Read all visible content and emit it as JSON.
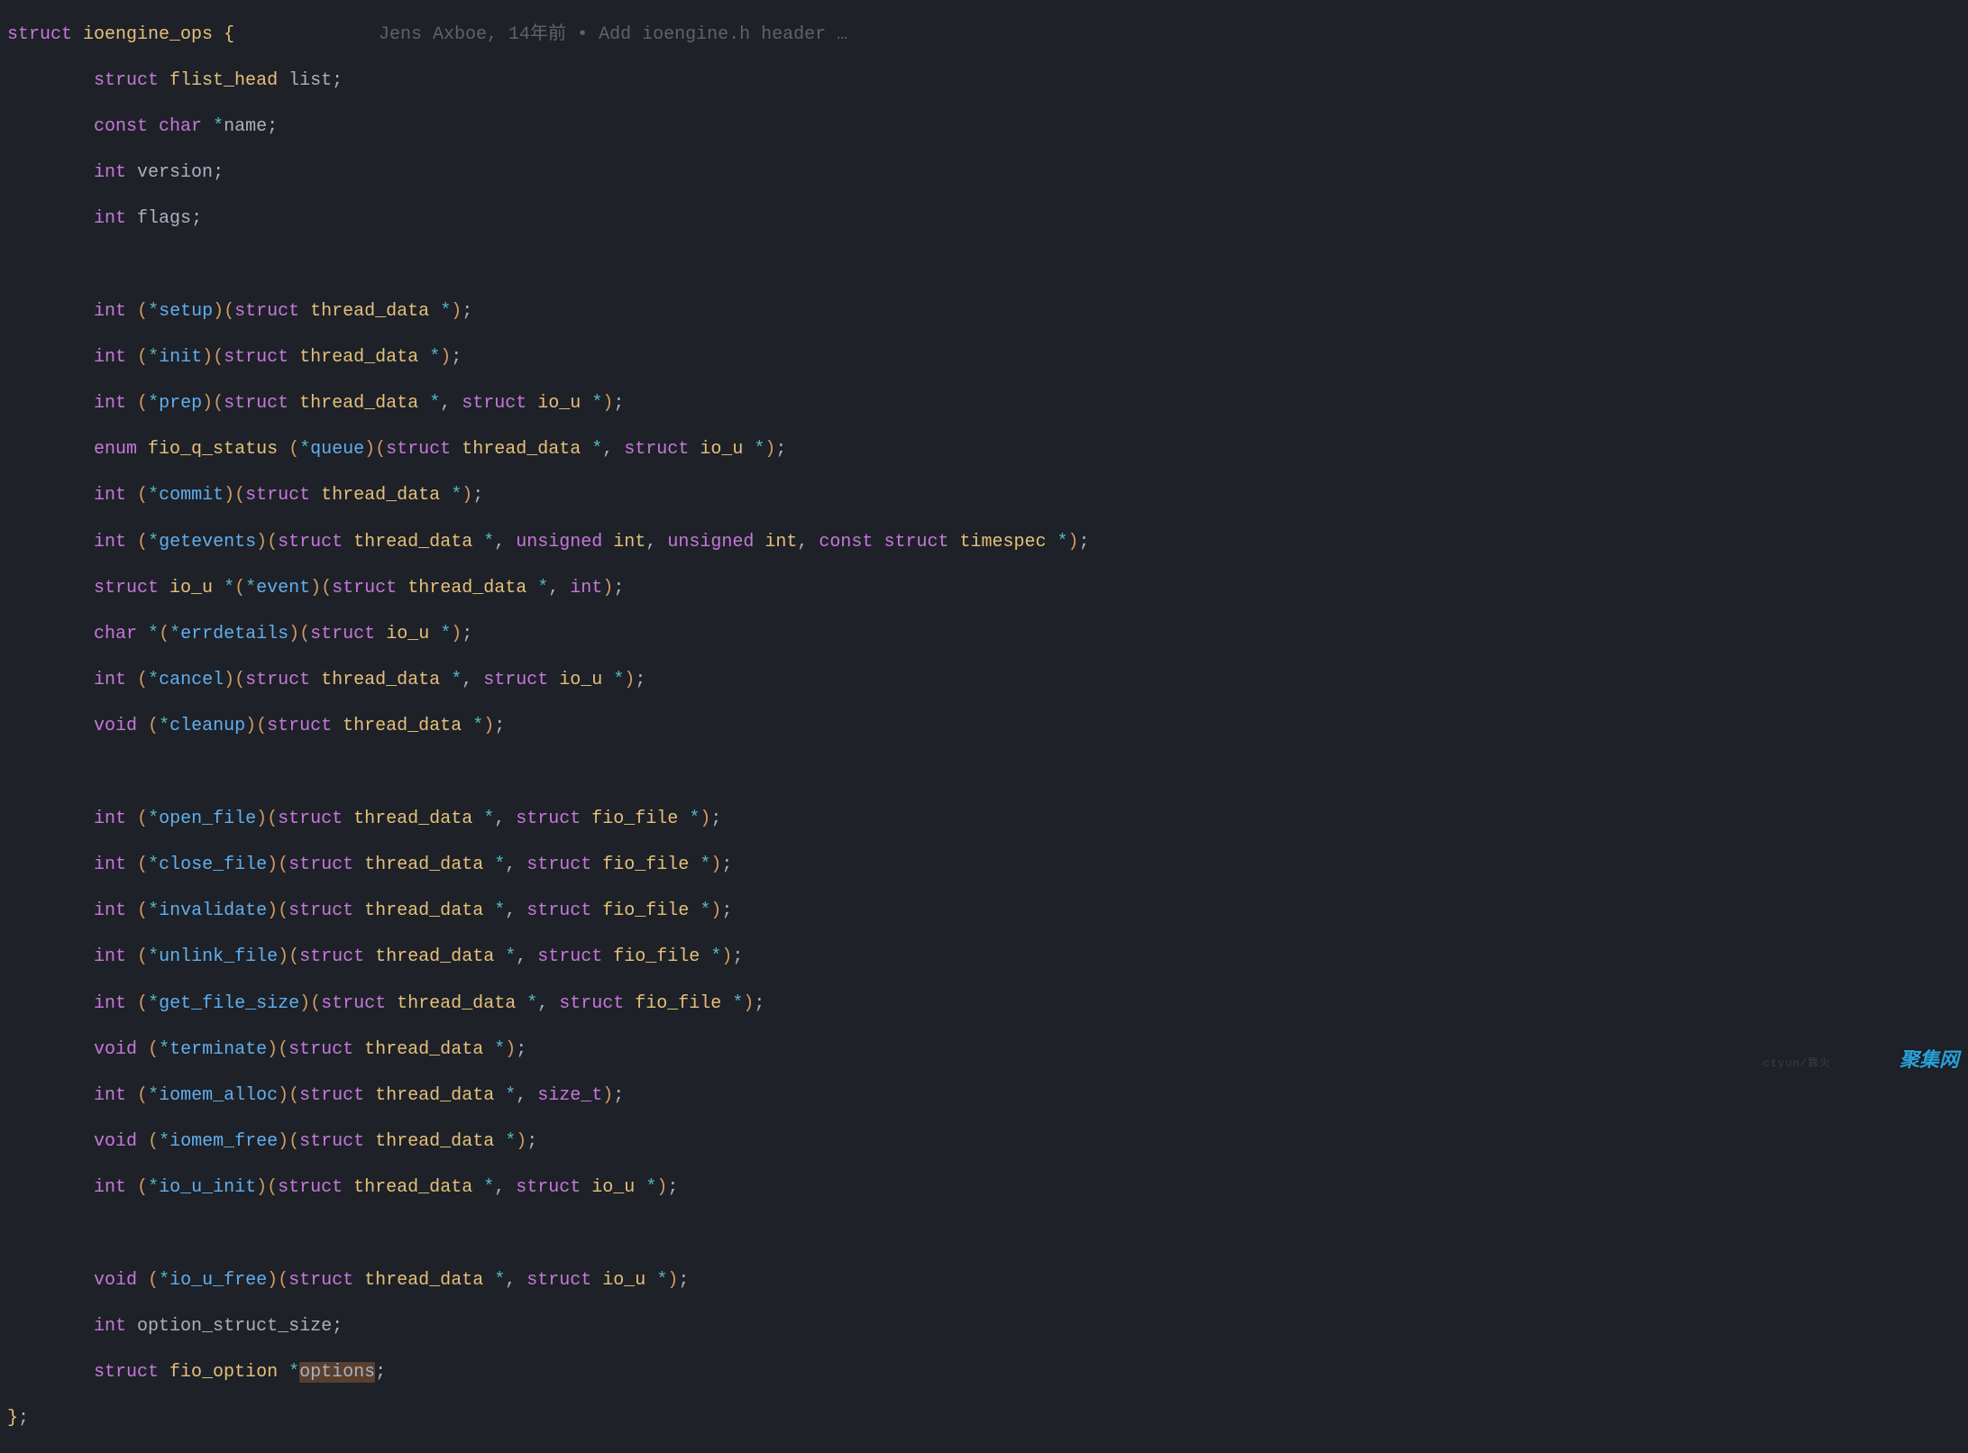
{
  "blame": {
    "author": "Jens Axboe",
    "age": "14年前",
    "sep": "•",
    "msg": "Add ioengine.h header …"
  },
  "watermark1": "ctyun/靠火",
  "watermark2": "聚集网",
  "code": {
    "l0": {
      "kw1": "struct",
      "type": "ioengine_ops",
      "brace": "{"
    },
    "l1": {
      "indent": "        ",
      "kw1": "struct",
      "type": "flist_head",
      "ident": "list",
      "semi": ";"
    },
    "l2": {
      "indent": "        ",
      "kw1": "const",
      "kw2": "char",
      "star": "*",
      "ident": "name",
      "semi": ";"
    },
    "l3": {
      "indent": "        ",
      "kw1": "int",
      "ident": "version",
      "semi": ";"
    },
    "l4": {
      "indent": "        ",
      "kw1": "int",
      "ident": "flags",
      "semi": ";"
    },
    "l6": {
      "indent": "        ",
      "ret": "int",
      "name": "setup",
      "params": [
        [
          "struct",
          "thread_data",
          "*"
        ]
      ]
    },
    "l7": {
      "indent": "        ",
      "ret": "int",
      "name": "init",
      "params": [
        [
          "struct",
          "thread_data",
          "*"
        ]
      ]
    },
    "l8": {
      "indent": "        ",
      "ret": "int",
      "name": "prep",
      "params": [
        [
          "struct",
          "thread_data",
          "*"
        ],
        [
          "struct",
          "io_u",
          "*"
        ]
      ]
    },
    "l9": {
      "indent": "        ",
      "ret_kw": "enum",
      "ret_type": "fio_q_status",
      "name": "queue",
      "params": [
        [
          "struct",
          "thread_data",
          "*"
        ],
        [
          "struct",
          "io_u",
          "*"
        ]
      ]
    },
    "l10": {
      "indent": "        ",
      "ret": "int",
      "name": "commit",
      "params": [
        [
          "struct",
          "thread_data",
          "*"
        ]
      ]
    },
    "l11": {
      "indent": "        ",
      "ret": "int",
      "name": "getevents",
      "params": [
        [
          "struct",
          "thread_data",
          "*"
        ],
        [
          "unsigned",
          "int",
          ""
        ],
        [
          "unsigned",
          "int",
          ""
        ],
        [
          "const struct",
          "timespec",
          "*"
        ]
      ]
    },
    "l12": {
      "indent": "        ",
      "ret_kw": "struct",
      "ret_type": "io_u",
      "ret_star": "*",
      "name": "event",
      "params": [
        [
          "struct",
          "thread_data",
          "*"
        ],
        [
          "int",
          "",
          ""
        ]
      ]
    },
    "l13": {
      "indent": "        ",
      "ret": "char",
      "ret_star": "*",
      "name": "errdetails",
      "params": [
        [
          "struct",
          "io_u",
          "*"
        ]
      ]
    },
    "l14": {
      "indent": "        ",
      "ret": "int",
      "name": "cancel",
      "params": [
        [
          "struct",
          "thread_data",
          "*"
        ],
        [
          "struct",
          "io_u",
          "*"
        ]
      ]
    },
    "l15": {
      "indent": "        ",
      "ret": "void",
      "name": "cleanup",
      "params": [
        [
          "struct",
          "thread_data",
          "*"
        ]
      ]
    },
    "l17": {
      "indent": "        ",
      "ret": "int",
      "name": "open_file",
      "params": [
        [
          "struct",
          "thread_data",
          "*"
        ],
        [
          "struct",
          "fio_file",
          "*"
        ]
      ]
    },
    "l18": {
      "indent": "        ",
      "ret": "int",
      "name": "close_file",
      "params": [
        [
          "struct",
          "thread_data",
          "*"
        ],
        [
          "struct",
          "fio_file",
          "*"
        ]
      ]
    },
    "l19": {
      "indent": "        ",
      "ret": "int",
      "name": "invalidate",
      "params": [
        [
          "struct",
          "thread_data",
          "*"
        ],
        [
          "struct",
          "fio_file",
          "*"
        ]
      ]
    },
    "l20": {
      "indent": "        ",
      "ret": "int",
      "name": "unlink_file",
      "params": [
        [
          "struct",
          "thread_data",
          "*"
        ],
        [
          "struct",
          "fio_file",
          "*"
        ]
      ]
    },
    "l21": {
      "indent": "        ",
      "ret": "int",
      "name": "get_file_size",
      "params": [
        [
          "struct",
          "thread_data",
          "*"
        ],
        [
          "struct",
          "fio_file",
          "*"
        ]
      ]
    },
    "l22": {
      "indent": "        ",
      "ret": "void",
      "name": "terminate",
      "params": [
        [
          "struct",
          "thread_data",
          "*"
        ]
      ]
    },
    "l23": {
      "indent": "        ",
      "ret": "int",
      "name": "iomem_alloc",
      "params": [
        [
          "struct",
          "thread_data",
          "*"
        ],
        [
          "size_t",
          "",
          ""
        ]
      ]
    },
    "l24": {
      "indent": "        ",
      "ret": "void",
      "name": "iomem_free",
      "params": [
        [
          "struct",
          "thread_data",
          "*"
        ]
      ]
    },
    "l25": {
      "indent": "        ",
      "ret": "int",
      "name": "io_u_init",
      "params": [
        [
          "struct",
          "thread_data",
          "*"
        ],
        [
          "struct",
          "io_u",
          "*"
        ]
      ]
    },
    "l27": {
      "indent": "        ",
      "ret": "void",
      "name": "io_u_free",
      "params": [
        [
          "struct",
          "thread_data",
          "*"
        ],
        [
          "struct",
          "io_u",
          "*"
        ]
      ]
    },
    "l28": {
      "indent": "        ",
      "kw1": "int",
      "ident": "option_struct_size",
      "semi": ";"
    },
    "l29": {
      "indent": "        ",
      "kw1": "struct",
      "type": "fio_option",
      "star": "*",
      "ident": "options",
      "semi": ";",
      "highlight": true
    },
    "l30": {
      "brace": "}",
      "semi": ";"
    }
  }
}
